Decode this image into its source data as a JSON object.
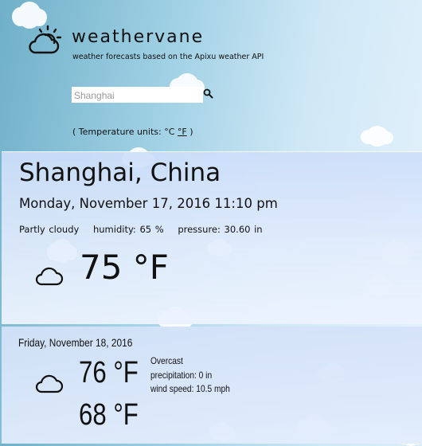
{
  "app": {
    "title": "weathervane",
    "subtitle": "weather forecasts based on the Apixu weather API",
    "logo_icon": "sun-cloud-icon"
  },
  "search": {
    "value": "Shanghai",
    "placeholder": "",
    "icon": "search-icon"
  },
  "units": {
    "prefix": "( Temperature units: °C ",
    "link_label": "°F",
    "suffix": " )"
  },
  "current": {
    "location": "Shanghai, China",
    "datetime": "Monday, November 17, 2016 11:10 pm",
    "condition": "Partly cloudy",
    "humidity": "humidity: 65 %",
    "pressure": "pressure: 30.60 in",
    "temperature": "75 °F",
    "icon": "cloud-icon"
  },
  "forecast": [
    {
      "date": "Friday, November 18, 2016",
      "high": "76 °F",
      "low": "68 °F",
      "condition": "Overcast",
      "precipitation": "precipitation: 0 in",
      "wind": "wind speed: 10.5 mph",
      "icon": "cloud-icon"
    }
  ],
  "colors": {
    "background_left": "#6fb0c8",
    "background_right": "#e6f2fc",
    "panel": "#dce8fb",
    "text": "#111111"
  }
}
